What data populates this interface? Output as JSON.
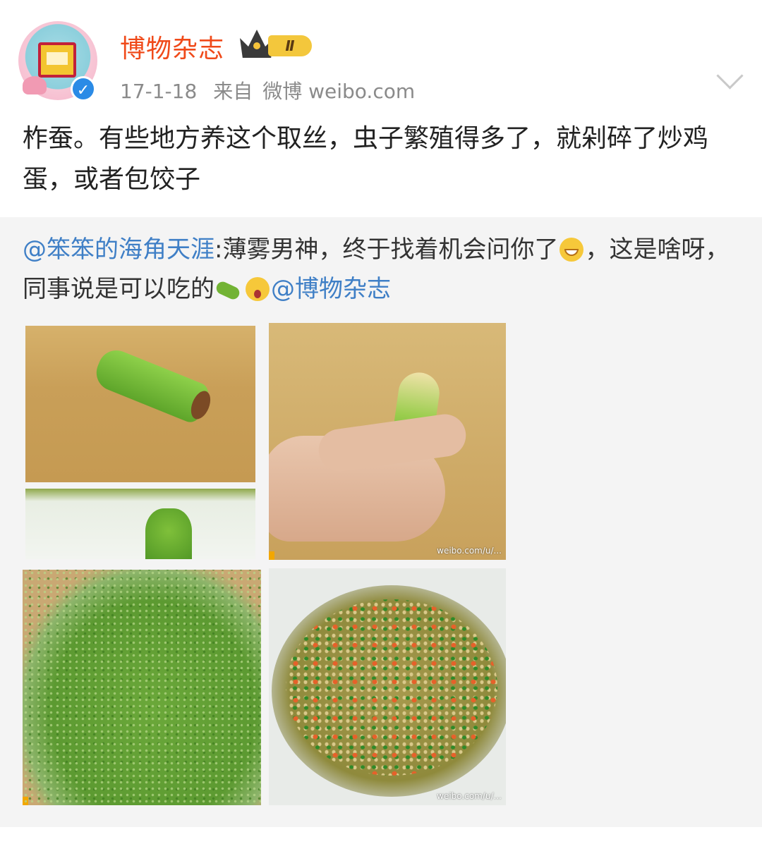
{
  "header": {
    "username": "博物杂志",
    "vip_level": "Ⅱ",
    "verified_badge": "✓",
    "date": "17-1-18",
    "source_prefix": "来自",
    "source_app": "微博 weibo.com"
  },
  "post": {
    "text": "柞蚕。有些地方养这个取丝，虫子繁殖得多了，就剁碎了炒鸡蛋，或者包饺子"
  },
  "repost": {
    "author_mention": "@笨笨的海角天涯",
    "text_part1": ":薄雾男神，终于找着机会问你了",
    "text_part2": "，这是啥呀，同事说是可以吃的",
    "mention_target": "@博物杂志",
    "images": [
      {
        "name": "sprout-on-board"
      },
      {
        "name": "sprout-closeup"
      },
      {
        "name": "sprout-in-hand",
        "watermark": "weibo.com/u/..."
      },
      {
        "name": "minced-green"
      },
      {
        "name": "fried-dish",
        "watermark": "weibo.com/u/..."
      }
    ]
  },
  "colors": {
    "username": "#f04a1a",
    "mention": "#3f7fc6",
    "meta": "#8a8a8a",
    "repost_bg": "#f4f4f4"
  }
}
